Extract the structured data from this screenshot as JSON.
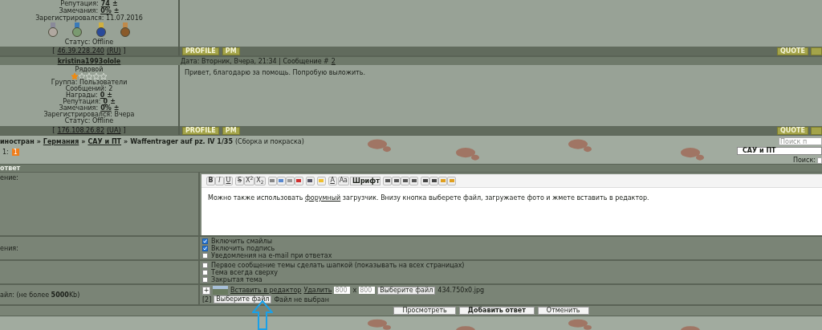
{
  "post_top": {
    "lines": [
      {
        "label": "Репутация:",
        "value": "74",
        "action": "±"
      },
      {
        "label": "Замечания:",
        "value": "0%",
        "action": "±"
      },
      {
        "label": "Зарегистрировался: 11.07.2016"
      }
    ],
    "status": "Статус: Offline",
    "open": "[",
    "ip": "46.39.228.240",
    "country": "(RU)",
    "close": "]",
    "buttons": [
      "PROFILE",
      "PM"
    ],
    "quote": "QUOTE"
  },
  "post": {
    "user": "kristina1993olole",
    "date": "Дата: Вторник, Вчера, 21:34 | Сообщение #",
    "number": "2",
    "rank": "Рядовой",
    "stars": 1,
    "lines": [
      {
        "label": "Группа: Пользователи"
      },
      {
        "label": "Сообщений: 2"
      },
      {
        "label": "Награды:",
        "value": "0",
        "action": "±"
      },
      {
        "label": "Репутация:",
        "value": "0",
        "action": "±"
      },
      {
        "label": "Замечания:",
        "value": "0%",
        "action": "±"
      },
      {
        "label": "Зарегистрировался: Вчера"
      }
    ],
    "status": "Статус: Offline",
    "open": "[",
    "ip": "176.108.26.82",
    "country": "(UA)",
    "close": "]",
    "text": "Привет, благодарю за помощь. Попробую выложить.",
    "buttons": [
      "PROFILE",
      "PM"
    ],
    "quote": "QUOTE"
  },
  "breadcrumbs": [
    {
      "label": "иностран",
      "link": false
    },
    {
      "sep": "»",
      "label": "Германия",
      "link": true
    },
    {
      "sep": "»",
      "label": "САУ и ПТ",
      "link": true
    },
    {
      "sep": "»",
      "label": "Waffentrager auf pz. IV 1/35",
      "link": false
    }
  ],
  "breadcrumb_note": "(Сборка и покраска)",
  "pages": {
    "label": "1:",
    "items": [
      {
        "label": "1",
        "selected": true
      }
    ]
  },
  "search": {
    "placeholder": "Поиск п",
    "forum": "САУ и ПТ",
    "label": "Поиск:"
  },
  "reply": {
    "title": "ответ",
    "message_label": "ение:",
    "options_label": "ения:",
    "file_label": "айл: (не более **5000**Kb)"
  },
  "toolbar": {
    "format": [
      "B",
      "I",
      "U"
    ],
    "script": [
      "S",
      "X$^{2}$",
      "X$_{2}$"
    ],
    "text_color_letter": "A",
    "size": "Aa",
    "font": "Шрифт"
  },
  "message": {
    "before": "Можно также использовать ",
    "link": "форумный",
    "after": " загрузчик. Внизу кнопка выберете файл, загружаете фото и жмете вставить в редактор."
  },
  "options": [
    {
      "label": "Включить смайлы",
      "checked": true
    },
    {
      "label": "Включить подпись",
      "checked": true
    },
    {
      "label": "Уведомления на e-mail при ответах",
      "checked": false
    }
  ],
  "topic_options": [
    {
      "label": "Первое сообщение темы сделать шапкой (показывать на всех страницах)",
      "checked": false
    },
    {
      "label": "Тема всегда сверху",
      "checked": false
    },
    {
      "label": "Закрытая тема",
      "checked": false
    }
  ],
  "attachments": {
    "add": "+",
    "insert": "Вставить в редактор",
    "delete": "Удалить",
    "width": {
      "placeholder": "800"
    },
    "times": "x",
    "height": {
      "placeholder": "800"
    },
    "choose": "Выберите файл",
    "filename": "434.750x0.jpg",
    "index": "[2]",
    "choose2": "Выберите файл",
    "none": "Файл не выбран"
  },
  "actions": [
    {
      "label": "Просмотреть",
      "primary": false
    },
    {
      "label": "Добавить ответ",
      "primary": true
    },
    {
      "label": "Отменить",
      "primary": false
    }
  ]
}
